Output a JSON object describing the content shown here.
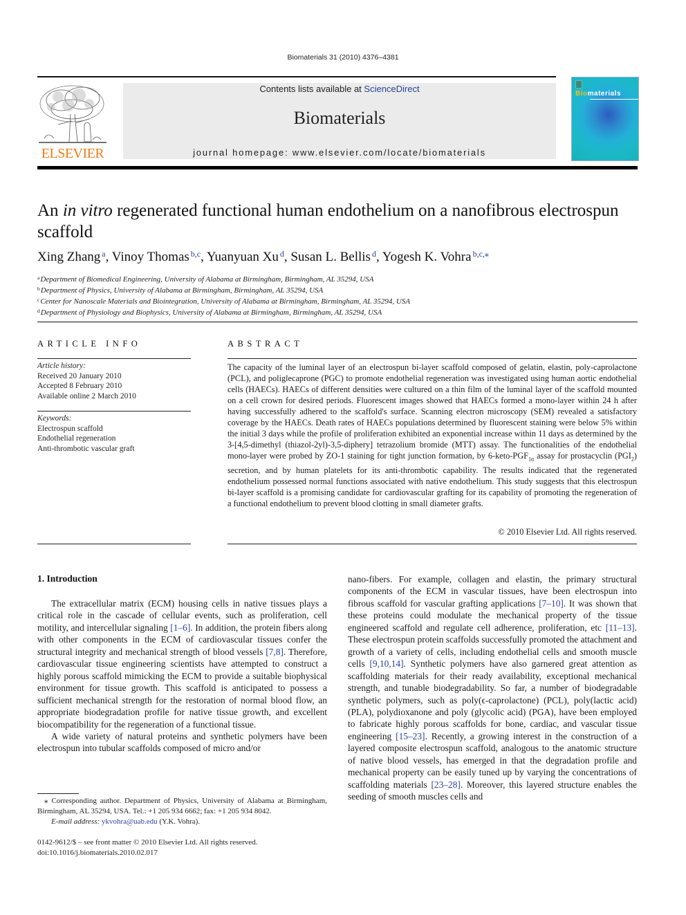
{
  "running_head": "Biomaterials 31 (2010) 4376–4381",
  "masthead": {
    "publisher_logo_text": "ELSEVIER",
    "contents_prefix": "Contents lists available at ",
    "contents_link": "ScienceDirect",
    "journal_name": "Biomaterials",
    "homepage": "journal homepage: www.elsevier.com/locate/biomaterials",
    "cover_title_highlight": "Bio",
    "cover_title_rest": "materials",
    "colors": {
      "elsevier_orange": "#f07c16",
      "masthead_gray": "#ebebeb",
      "link_blue": "#2a3f9c",
      "cover_teal": "#19b3b9"
    }
  },
  "article": {
    "title_pre": "An ",
    "title_italic": "in vitro",
    "title_post": " regenerated functional human endothelium on a nanofibrous electrospun scaffold",
    "authors": [
      {
        "name": "Xing Zhang",
        "sup": "a",
        "sep": ", "
      },
      {
        "name": "Vinoy Thomas",
        "sup": "b,c",
        "sep": ", "
      },
      {
        "name": "Yuanyuan Xu",
        "sup": "d",
        "sep": ", "
      },
      {
        "name": "Susan L. Bellis",
        "sup": "d",
        "sep": ", "
      },
      {
        "name": "Yogesh K. Vohra",
        "sup": "b,c,⁎",
        "sep": ""
      }
    ],
    "affiliations": [
      {
        "key": "a",
        "text": "Department of Biomedical Engineering, University of Alabama at Birmingham, Birmingham, AL 35294, USA"
      },
      {
        "key": "b",
        "text": "Department of Physics, University of Alabama at Birmingham, Birmingham, AL 35294, USA"
      },
      {
        "key": "c",
        "text": "Center for Nanoscale Materials and Biointegration, University of Alabama at Birmingham, Birmingham, AL 35294, USA"
      },
      {
        "key": "d",
        "text": "Department of Physiology and Biophysics, University of Alabama at Birmingham, Birmingham, AL 35294, USA"
      }
    ]
  },
  "article_info": {
    "heading": "ARTICLE INFO",
    "history_label": "Article history:",
    "history": [
      "Received 20 January 2010",
      "Accepted 8 February 2010",
      "Available online 2 March 2010"
    ],
    "keywords_label": "Keywords:",
    "keywords": [
      "Electrospun scaffold",
      "Endothelial regeneration",
      "Anti-thrombotic vascular graft"
    ]
  },
  "abstract": {
    "heading": "ABSTRACT",
    "text_1": "The capacity of the luminal layer of an electrospun bi-layer scaffold composed of gelatin, elastin, poly-caprolactone (PCL), and poliglecaprone (PGC) to promote endothelial regeneration was investigated using human aortic endothelial cells (HAECs). HAECs of different densities were cultured on a thin film of the luminal layer of the scaffold mounted on a cell crown for desired periods. Fluorescent images showed that HAECs formed a mono-layer within 24 h after having successfully adhered to the scaffold's surface. Scanning electron microscopy (SEM) revealed a satisfactory coverage by the HAECs. Death rates of HAECs populations determined by fluorescent staining were below 5% within the initial 3 days while the profile of proliferation exhibited an exponential increase within 11 days as determined by the 3-[4,5-dimethyl (thiazol-2yl)-3,5-diphery] tetrazolium bromide (MTT) assay. The functionalities of the endothelial mono-layer were probed by ZO-1 staining for tight junction formation, by 6-keto-PGF",
    "sub_1": "1α",
    "text_2": " assay for prostacyclin (PGI",
    "sub_2": "2",
    "text_3": ") secretion, and by human platelets for its anti-thrombotic capability. The results indicated that the regenerated endothelium possessed normal functions associated with native endothelium. This study suggests that this electrospun bi-layer scaffold is a promising candidate for cardiovascular grafting for its capability of promoting the regeneration of a functional endothelium to prevent blood clotting in small diameter grafts.",
    "copyright": "© 2010 Elsevier Ltd. All rights reserved."
  },
  "introduction": {
    "heading": "1.  Introduction",
    "left": {
      "p1_a": "The extracellular matrix (ECM) housing cells in native tissues plays a critical role in the cascade of cellular events, such as proliferation, cell motility, and intercellular signaling ",
      "p1_ref1": "[1–6]",
      "p1_b": ". In addition, the protein fibers along with other components in the ECM of cardiovascular tissues confer the structural integrity and mechanical strength of blood vessels ",
      "p1_ref2": "[7,8]",
      "p1_c": ". Therefore, cardiovascular tissue engineering scientists have attempted to construct a highly porous scaffold mimicking the ECM to provide a suitable biophysical environment for tissue growth. This scaffold is anticipated to possess a sufficient mechanical strength for the restoration of normal blood flow, an appropriate biodegradation profile for native tissue growth, and excellent biocompatibility for the regeneration of a functional tissue.",
      "p2": "A wide variety of natural proteins and synthetic polymers have been electrospun into tubular scaffolds composed of micro and/or"
    },
    "right": {
      "a": "nano-fibers. For example, collagen and elastin, the primary structural components of the ECM in vascular tissues, have been electrospun into fibrous scaffold for vascular grafting applications ",
      "ref1": "[7–10]",
      "b": ". It was shown that these proteins could modulate the mechanical property of the tissue engineered scaffold and regulate cell adherence, proliferation, etc ",
      "ref2": "[11–13]",
      "c": ". These electrospun protein scaffolds successfully promoted the attachment and growth of a variety of cells, including endothelial cells and smooth muscle cells ",
      "ref3": "[9,10,14]",
      "d": ". Synthetic polymers have also garnered great attention as scaffolding materials for their ready availability, exceptional mechanical strength, and tunable biodegradability. So far, a number of biodegradable synthetic polymers, such as poly(ϵ-caprolactone) (PCL), poly(lactic acid) (PLA), polydioxanone and poly (glycolic acid) (PGA), have been employed to fabricate highly porous scaffolds for bone, cardiac, and vascular tissue engineering ",
      "ref4": "[15–23]",
      "e": ". Recently, a growing interest in the construction of a layered composite electrospun scaffold, analogous to the anatomic structure of native blood vessels, has emerged in that the degradation profile and mechanical property can be easily tuned up by varying the concentrations of scaffolding materials ",
      "ref5": "[23–28]",
      "f": ". Moreover, this layered structure enables the seeding of smooth muscles cells and"
    }
  },
  "footnote": {
    "star": "⁎",
    "corresponding": " Corresponding author. Department of Physics, University of Alabama at Birmingham, Birmingham, AL 35294, USA. Tel.: +1 205 934 6662; fax: +1 205 934 8042.",
    "email_label": "E-mail address:",
    "email": "ykvohra@uab.edu",
    "email_suffix": " (Y.K. Vohra)."
  },
  "front_matter": {
    "issn_line": "0142-9612/$ – see front matter © 2010 Elsevier Ltd. All rights reserved.",
    "doi": "doi:10.1016/j.biomaterials.2010.02.017"
  }
}
